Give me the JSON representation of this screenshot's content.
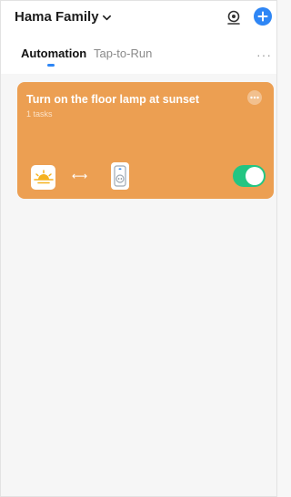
{
  "header": {
    "home_name": "Hama Family",
    "icons": {
      "home_dropdown": "chevron-down-icon",
      "camera": "camera-icon",
      "add": "add-icon"
    }
  },
  "tabs": [
    {
      "label": "Automation",
      "active": true
    },
    {
      "label": "Tap-to-Run",
      "active": false
    }
  ],
  "more_menu": "···",
  "automations": [
    {
      "title": "Turn on the floor lamp at sunset",
      "subtitle": "1 tasks",
      "condition_icon": "sunset-icon",
      "arrow": "⟷",
      "action_icon": "smart-plug-icon",
      "enabled": true
    }
  ],
  "colors": {
    "card": "#ec9f52",
    "accent": "#2e86f5",
    "toggle_on": "#23c582"
  }
}
